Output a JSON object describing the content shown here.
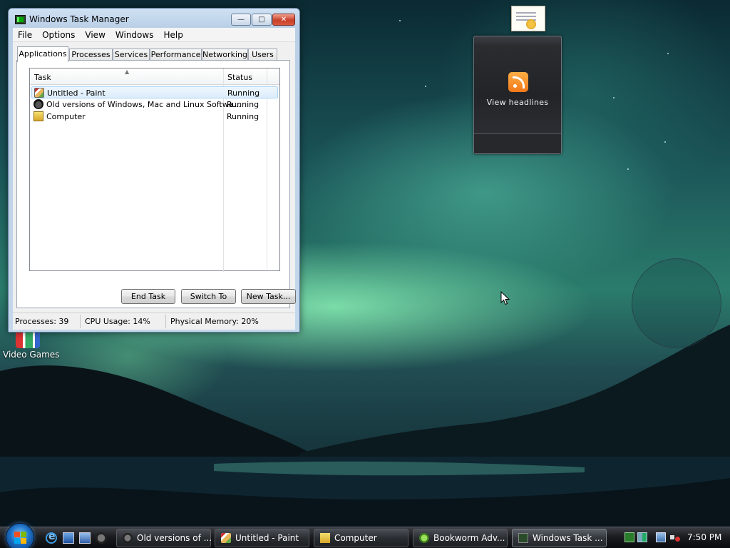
{
  "window": {
    "title": "Windows Task Manager",
    "menu": [
      "File",
      "Options",
      "View",
      "Windows",
      "Help"
    ],
    "tabs": [
      "Applications",
      "Processes",
      "Services",
      "Performance",
      "Networking",
      "Users"
    ],
    "active_tab": "Applications",
    "columns": {
      "task": "Task",
      "status": "Status"
    },
    "rows": [
      {
        "task": "Untitled - Paint",
        "status": "Running",
        "icon": "paint-icon",
        "selected": true
      },
      {
        "task": "Old versions of Windows, Mac and Linux Softwa...",
        "status": "Running",
        "icon": "raccoon-icon",
        "selected": false
      },
      {
        "task": "Computer",
        "status": "Running",
        "icon": "computer-icon",
        "selected": false
      }
    ],
    "buttons": {
      "end_task": "End Task",
      "switch_to": "Switch To",
      "new_task": "New Task..."
    },
    "status": {
      "processes": "Processes: 39",
      "cpu": "CPU Usage: 14%",
      "memory": "Physical Memory: 20%"
    }
  },
  "desktop": {
    "icon_label": "Video Games",
    "gadget_headline": "View headlines"
  },
  "taskbar": {
    "buttons": [
      {
        "label": "Old versions of ...",
        "icon": "raccoon-icon"
      },
      {
        "label": "Untitled - Paint",
        "icon": "paint-icon"
      },
      {
        "label": "Computer",
        "icon": "computer-icon"
      },
      {
        "label": "Bookworm Adv...",
        "icon": "bookworm-icon"
      },
      {
        "label": "Windows Task ...",
        "icon": "task-manager-icon"
      }
    ],
    "clock": "7:50 PM"
  },
  "colors": {
    "title_bar": "#c4d8ec",
    "close_button": "#c7402a",
    "selection": "#dcecfb",
    "taskbar": "#1a1c1f"
  }
}
